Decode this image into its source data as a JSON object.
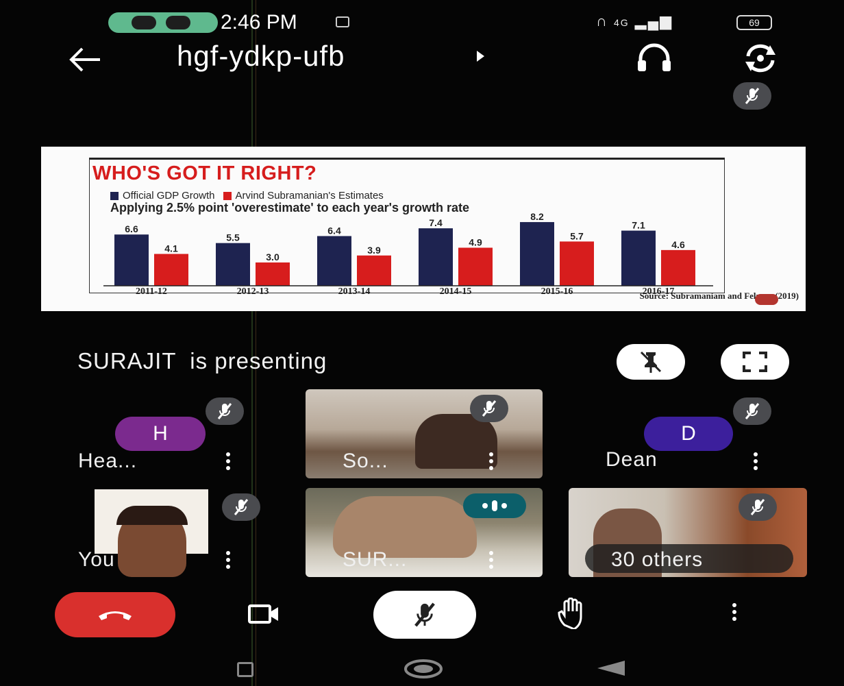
{
  "status_bar": {
    "time": "2:46 PM",
    "battery": "69",
    "signal_text": "4G"
  },
  "header": {
    "meeting_code": "hgf-ydkp-ufb"
  },
  "presentation": {
    "title": "WHO'S GOT IT RIGHT?",
    "legend": [
      "Official GDP Growth",
      "Arvind Subramanian's Estimates"
    ],
    "subheading": "Applying 2.5% point 'overestimate' to each year's growth rate",
    "source": "Source: Subramaniam and Felman (2019)",
    "chart_data": {
      "type": "bar",
      "title": "WHO'S GOT IT RIGHT?",
      "categories": [
        "2011-12",
        "2012-13",
        "2013-14",
        "2014-15",
        "2015-16",
        "2016-17"
      ],
      "series": [
        {
          "name": "Official GDP Growth",
          "values": [
            6.6,
            5.5,
            6.4,
            7.4,
            8.2,
            7.1
          ],
          "color": "#1e2350"
        },
        {
          "name": "Arvind Subramanian's Estimates",
          "values": [
            4.1,
            3.0,
            3.9,
            4.9,
            5.7,
            4.6
          ],
          "color": "#d71d1d"
        }
      ],
      "value_labels": {
        "series0": [
          "6.6",
          "5.5",
          "6.4",
          "7.4",
          "8.2",
          "7.1"
        ],
        "series1": [
          "4.1",
          "3.0",
          "3.9",
          "4.9",
          "5.7",
          "4.6"
        ]
      },
      "ylim": [
        0,
        9
      ],
      "grid": false,
      "legend_position": "top-left"
    }
  },
  "presenting": {
    "text": "SURAJIT  is presenting"
  },
  "participants": [
    {
      "name": "Hea...",
      "initial": "H",
      "avatar_color": "#7b2a8e"
    },
    {
      "name": "So..."
    },
    {
      "name": "Dean",
      "initial": "D",
      "avatar_color": "#3c1f9c"
    },
    {
      "name": "You"
    },
    {
      "name": "SUR..."
    },
    {
      "name": "30 others"
    }
  ],
  "icons": {
    "back": "back-arrow-icon",
    "headset": "headset-icon",
    "switch_camera": "switch-camera-icon",
    "mic_off": "mic-off-icon",
    "unpin": "unpin-icon",
    "fullscreen": "fullscreen-icon",
    "end_call": "end-call-icon",
    "camera": "camera-icon",
    "raise_hand": "raise-hand-icon",
    "more": "more-vert-icon"
  }
}
